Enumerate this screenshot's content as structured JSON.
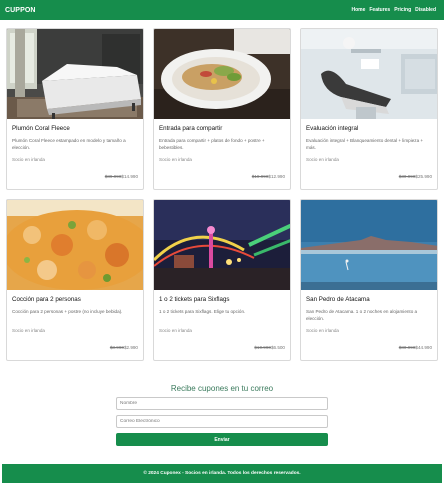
{
  "navbar": {
    "brand": "CUPPON",
    "links": [
      "Home",
      "Features",
      "Pricing",
      "Disabled"
    ]
  },
  "cards": [
    {
      "title": "Plumón Coral Fleece",
      "desc": "Plumón Coral Fleece estampado en modelo y tamaño a elección.",
      "partner": "Socio en irlanda",
      "old_price": "$89.990",
      "new_price": "$14.990",
      "image": "bedroom-photo"
    },
    {
      "title": "Entrada para compartir",
      "desc": "Entrada para compartir + platos de fondo + postre + bebestibles.",
      "partner": "Socio en irlanda",
      "old_price": "$18.990",
      "new_price": "$12.990",
      "image": "food-plate-photo"
    },
    {
      "title": "Evaluación integral",
      "desc": "Evaluación integral + Blanqueamiento dental + limpieza + más.",
      "partner": "Socio en irlanda",
      "old_price": "$30.990",
      "new_price": "$25.990",
      "image": "dental-clinic-photo"
    },
    {
      "title": "Cocción para 2 personas",
      "desc": "Cocción para 2 personas + postre (no incluye bebida).",
      "partner": "Socio en irlanda",
      "old_price": "$3.990",
      "new_price": "$2.990",
      "image": "seafood-photo"
    },
    {
      "title": "1 o 2 tickets para Sixflags",
      "desc": "1 o 2 tickets para Sixflags. Elige tu opción.",
      "partner": "Socio en irlanda",
      "old_price": "$10.990",
      "new_price": "$6.500",
      "image": "amusement-park-photo"
    },
    {
      "title": "San Pedro de Atacama",
      "desc": "San Pedro de Atacama. 1 o 2 noches en alojamiento a elección.",
      "partner": "Socio en irlanda",
      "old_price": "$80.990",
      "new_price": "$44.990",
      "image": "atacama-lake-photo"
    }
  ],
  "newsletter": {
    "heading": "Recibe cupones en tu correo",
    "name_placeholder": "Nombre",
    "email_placeholder": "Correo Electrónico",
    "submit_label": "Enviar"
  },
  "footer": {
    "text": "© 2024 Cuponex - Socios en irlanda. Todos los derechos reservados."
  },
  "colors": {
    "brand_green": "#168d4c",
    "heading_green": "#3a7a5c"
  }
}
